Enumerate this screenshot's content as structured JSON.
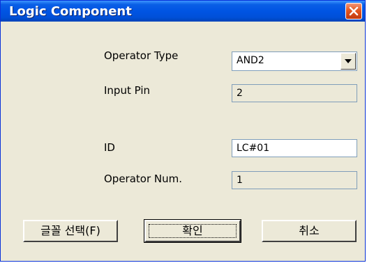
{
  "window": {
    "title": "Logic Component",
    "close_icon": "close-icon"
  },
  "form": {
    "operator_type": {
      "label": "Operator Type",
      "value": "AND2"
    },
    "input_pin": {
      "label": "Input Pin",
      "value": "2"
    },
    "id": {
      "label": "ID",
      "value": "LC#01"
    },
    "operator_num": {
      "label": "Operator Num.",
      "value": "1"
    }
  },
  "buttons": {
    "font_select": "글꼴 선택(F)",
    "ok": "확인",
    "cancel": "취소"
  },
  "colors": {
    "titlebar": "#0054e3",
    "face": "#ece9d8",
    "close": "#e3561f",
    "field_border": "#7f9db9"
  }
}
